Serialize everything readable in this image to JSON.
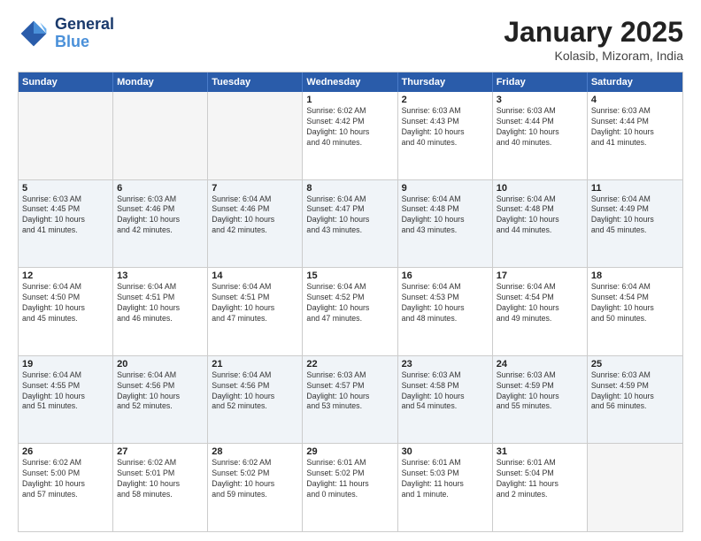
{
  "logo": {
    "line1": "General",
    "line2": "Blue"
  },
  "title": "January 2025",
  "subtitle": "Kolasib, Mizoram, India",
  "header_days": [
    "Sunday",
    "Monday",
    "Tuesday",
    "Wednesday",
    "Thursday",
    "Friday",
    "Saturday"
  ],
  "weeks": [
    [
      {
        "day": "",
        "info": ""
      },
      {
        "day": "",
        "info": ""
      },
      {
        "day": "",
        "info": ""
      },
      {
        "day": "1",
        "info": "Sunrise: 6:02 AM\nSunset: 4:42 PM\nDaylight: 10 hours\nand 40 minutes."
      },
      {
        "day": "2",
        "info": "Sunrise: 6:03 AM\nSunset: 4:43 PM\nDaylight: 10 hours\nand 40 minutes."
      },
      {
        "day": "3",
        "info": "Sunrise: 6:03 AM\nSunset: 4:44 PM\nDaylight: 10 hours\nand 40 minutes."
      },
      {
        "day": "4",
        "info": "Sunrise: 6:03 AM\nSunset: 4:44 PM\nDaylight: 10 hours\nand 41 minutes."
      }
    ],
    [
      {
        "day": "5",
        "info": "Sunrise: 6:03 AM\nSunset: 4:45 PM\nDaylight: 10 hours\nand 41 minutes."
      },
      {
        "day": "6",
        "info": "Sunrise: 6:03 AM\nSunset: 4:46 PM\nDaylight: 10 hours\nand 42 minutes."
      },
      {
        "day": "7",
        "info": "Sunrise: 6:04 AM\nSunset: 4:46 PM\nDaylight: 10 hours\nand 42 minutes."
      },
      {
        "day": "8",
        "info": "Sunrise: 6:04 AM\nSunset: 4:47 PM\nDaylight: 10 hours\nand 43 minutes."
      },
      {
        "day": "9",
        "info": "Sunrise: 6:04 AM\nSunset: 4:48 PM\nDaylight: 10 hours\nand 43 minutes."
      },
      {
        "day": "10",
        "info": "Sunrise: 6:04 AM\nSunset: 4:48 PM\nDaylight: 10 hours\nand 44 minutes."
      },
      {
        "day": "11",
        "info": "Sunrise: 6:04 AM\nSunset: 4:49 PM\nDaylight: 10 hours\nand 45 minutes."
      }
    ],
    [
      {
        "day": "12",
        "info": "Sunrise: 6:04 AM\nSunset: 4:50 PM\nDaylight: 10 hours\nand 45 minutes."
      },
      {
        "day": "13",
        "info": "Sunrise: 6:04 AM\nSunset: 4:51 PM\nDaylight: 10 hours\nand 46 minutes."
      },
      {
        "day": "14",
        "info": "Sunrise: 6:04 AM\nSunset: 4:51 PM\nDaylight: 10 hours\nand 47 minutes."
      },
      {
        "day": "15",
        "info": "Sunrise: 6:04 AM\nSunset: 4:52 PM\nDaylight: 10 hours\nand 47 minutes."
      },
      {
        "day": "16",
        "info": "Sunrise: 6:04 AM\nSunset: 4:53 PM\nDaylight: 10 hours\nand 48 minutes."
      },
      {
        "day": "17",
        "info": "Sunrise: 6:04 AM\nSunset: 4:54 PM\nDaylight: 10 hours\nand 49 minutes."
      },
      {
        "day": "18",
        "info": "Sunrise: 6:04 AM\nSunset: 4:54 PM\nDaylight: 10 hours\nand 50 minutes."
      }
    ],
    [
      {
        "day": "19",
        "info": "Sunrise: 6:04 AM\nSunset: 4:55 PM\nDaylight: 10 hours\nand 51 minutes."
      },
      {
        "day": "20",
        "info": "Sunrise: 6:04 AM\nSunset: 4:56 PM\nDaylight: 10 hours\nand 52 minutes."
      },
      {
        "day": "21",
        "info": "Sunrise: 6:04 AM\nSunset: 4:56 PM\nDaylight: 10 hours\nand 52 minutes."
      },
      {
        "day": "22",
        "info": "Sunrise: 6:03 AM\nSunset: 4:57 PM\nDaylight: 10 hours\nand 53 minutes."
      },
      {
        "day": "23",
        "info": "Sunrise: 6:03 AM\nSunset: 4:58 PM\nDaylight: 10 hours\nand 54 minutes."
      },
      {
        "day": "24",
        "info": "Sunrise: 6:03 AM\nSunset: 4:59 PM\nDaylight: 10 hours\nand 55 minutes."
      },
      {
        "day": "25",
        "info": "Sunrise: 6:03 AM\nSunset: 4:59 PM\nDaylight: 10 hours\nand 56 minutes."
      }
    ],
    [
      {
        "day": "26",
        "info": "Sunrise: 6:02 AM\nSunset: 5:00 PM\nDaylight: 10 hours\nand 57 minutes."
      },
      {
        "day": "27",
        "info": "Sunrise: 6:02 AM\nSunset: 5:01 PM\nDaylight: 10 hours\nand 58 minutes."
      },
      {
        "day": "28",
        "info": "Sunrise: 6:02 AM\nSunset: 5:02 PM\nDaylight: 10 hours\nand 59 minutes."
      },
      {
        "day": "29",
        "info": "Sunrise: 6:01 AM\nSunset: 5:02 PM\nDaylight: 11 hours\nand 0 minutes."
      },
      {
        "day": "30",
        "info": "Sunrise: 6:01 AM\nSunset: 5:03 PM\nDaylight: 11 hours\nand 1 minute."
      },
      {
        "day": "31",
        "info": "Sunrise: 6:01 AM\nSunset: 5:04 PM\nDaylight: 11 hours\nand 2 minutes."
      },
      {
        "day": "",
        "info": ""
      }
    ]
  ]
}
